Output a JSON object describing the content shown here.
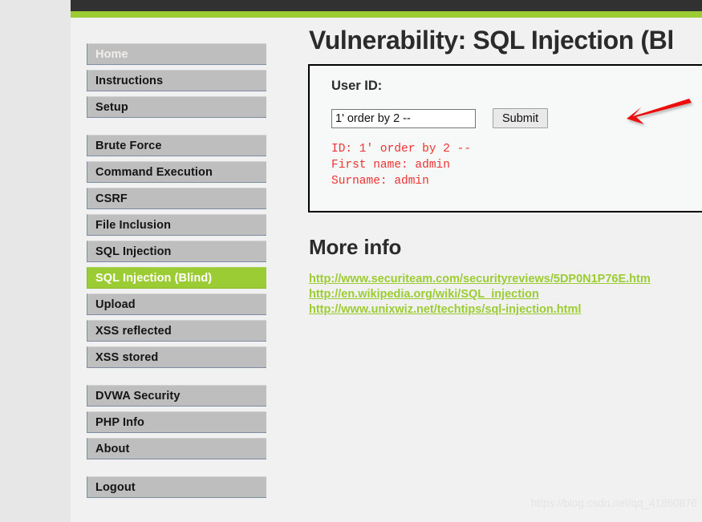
{
  "theme": {
    "top_bar_color": "#313131",
    "accent_green": "#9ccc33",
    "nav_item_bg": "#bebebe",
    "result_red": "#ef3232",
    "page_bg": "#f1f1f1"
  },
  "header": {
    "title": "Vulnerability: SQL Injection (Bl"
  },
  "sidebar": {
    "groups": [
      {
        "items": [
          {
            "label": "Home",
            "state": "disabled"
          },
          {
            "label": "Instructions",
            "state": "normal"
          },
          {
            "label": "Setup",
            "state": "normal"
          }
        ]
      },
      {
        "items": [
          {
            "label": "Brute Force",
            "state": "normal"
          },
          {
            "label": "Command Execution",
            "state": "normal"
          },
          {
            "label": "CSRF",
            "state": "normal"
          },
          {
            "label": "File Inclusion",
            "state": "normal"
          },
          {
            "label": "SQL Injection",
            "state": "normal"
          },
          {
            "label": "SQL Injection (Blind)",
            "state": "active"
          },
          {
            "label": "Upload",
            "state": "normal"
          },
          {
            "label": "XSS reflected",
            "state": "normal"
          },
          {
            "label": "XSS stored",
            "state": "normal"
          }
        ]
      },
      {
        "items": [
          {
            "label": "DVWA Security",
            "state": "normal"
          },
          {
            "label": "PHP Info",
            "state": "normal"
          },
          {
            "label": "About",
            "state": "normal"
          }
        ]
      },
      {
        "items": [
          {
            "label": "Logout",
            "state": "normal"
          }
        ]
      }
    ]
  },
  "vulnerability_form": {
    "legend": "User ID:",
    "input_value": "1' order by 2 --",
    "input_placeholder": "",
    "submit_label": "Submit",
    "result_lines": [
      "ID: 1' order by 2 --",
      "First name: admin",
      "Surname: admin"
    ],
    "result_text": "ID: 1' order by 2 --\nFirst name: admin\nSurname: admin"
  },
  "more_info": {
    "title": "More info",
    "links": [
      "http://www.securiteam.com/securityreviews/5DP0N1P76E.htm",
      "http://en.wikipedia.org/wiki/SQL_injection",
      "http://www.unixwiz.net/techtips/sql-injection.html"
    ]
  },
  "annotation": {
    "arrow_color": "#ee1111",
    "arrow_target": "submit-button"
  },
  "watermark": {
    "text": "https://blog.csdn.net/qq_41860876"
  }
}
